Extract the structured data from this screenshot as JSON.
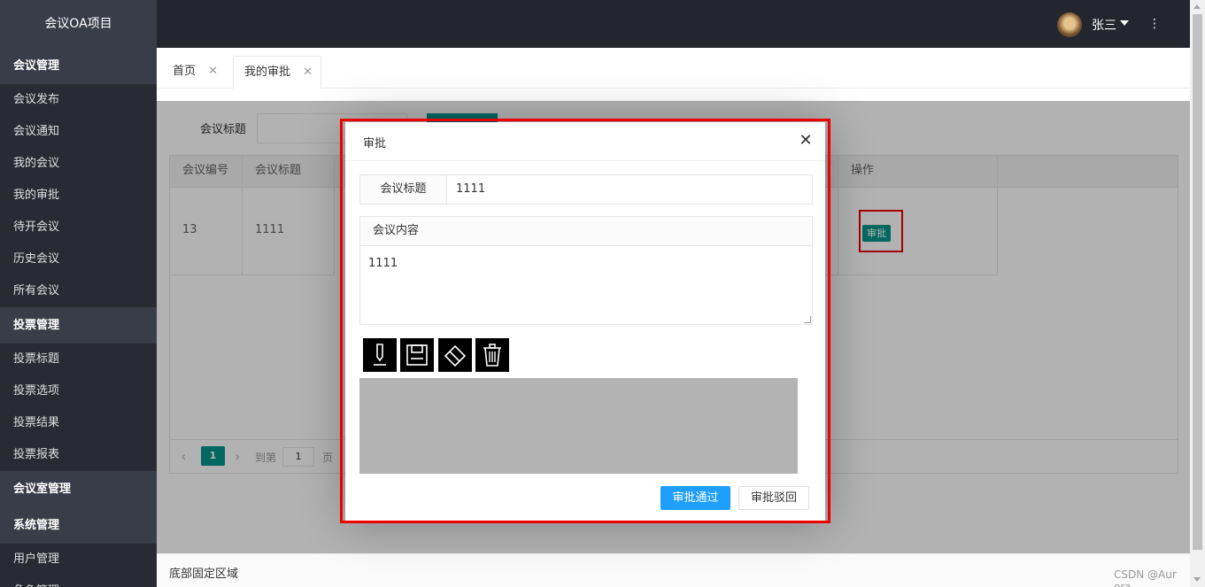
{
  "app": {
    "title": "会议OA项目"
  },
  "sidebar": {
    "groups": [
      {
        "label": "会议管理",
        "items": [
          "会议发布",
          "会议通知",
          "我的会议",
          "我的审批",
          "待开会议",
          "历史会议",
          "所有会议"
        ]
      },
      {
        "label": "投票管理",
        "items": [
          "投票标题",
          "投票选项",
          "投票结果",
          "投票报表"
        ]
      },
      {
        "label": "会议室管理",
        "items": []
      },
      {
        "label": "系统管理",
        "items": [
          "用户管理",
          "角色管理"
        ]
      }
    ]
  },
  "header": {
    "username": "张三",
    "more_icon": "⋮"
  },
  "tabs": [
    {
      "label": "首页",
      "close": "✕"
    },
    {
      "label": "我的审批",
      "close": "✕"
    }
  ],
  "search": {
    "label": "会议标题",
    "placeholder": ""
  },
  "table": {
    "columns": [
      "会议编号",
      "会议标题",
      "操作"
    ],
    "rows": [
      {
        "id": "13",
        "title": "1111",
        "action": "审批",
        "ellipsis": "."
      }
    ]
  },
  "pager": {
    "prev": "‹",
    "current": "1",
    "next": "›",
    "goto": "到第",
    "input": "1",
    "page": "页"
  },
  "footer": {
    "text": "底部固定区域"
  },
  "watermark": "CSDN @Aur ora",
  "modal": {
    "title": "审批",
    "close": "✕",
    "title_label": "会议标题",
    "title_value": "1111",
    "content_label": "会议内容",
    "content_value": "1111",
    "tools": [
      "pen-icon",
      "save-icon",
      "eraser-icon",
      "trash-icon"
    ],
    "approve_label": "审批通过",
    "reject_label": "审批驳回"
  },
  "colors": {
    "accent": "#009688",
    "primary": "#1e9fff",
    "highlight": "#e00000",
    "sidebar": "#393d49",
    "header": "#23262e"
  }
}
